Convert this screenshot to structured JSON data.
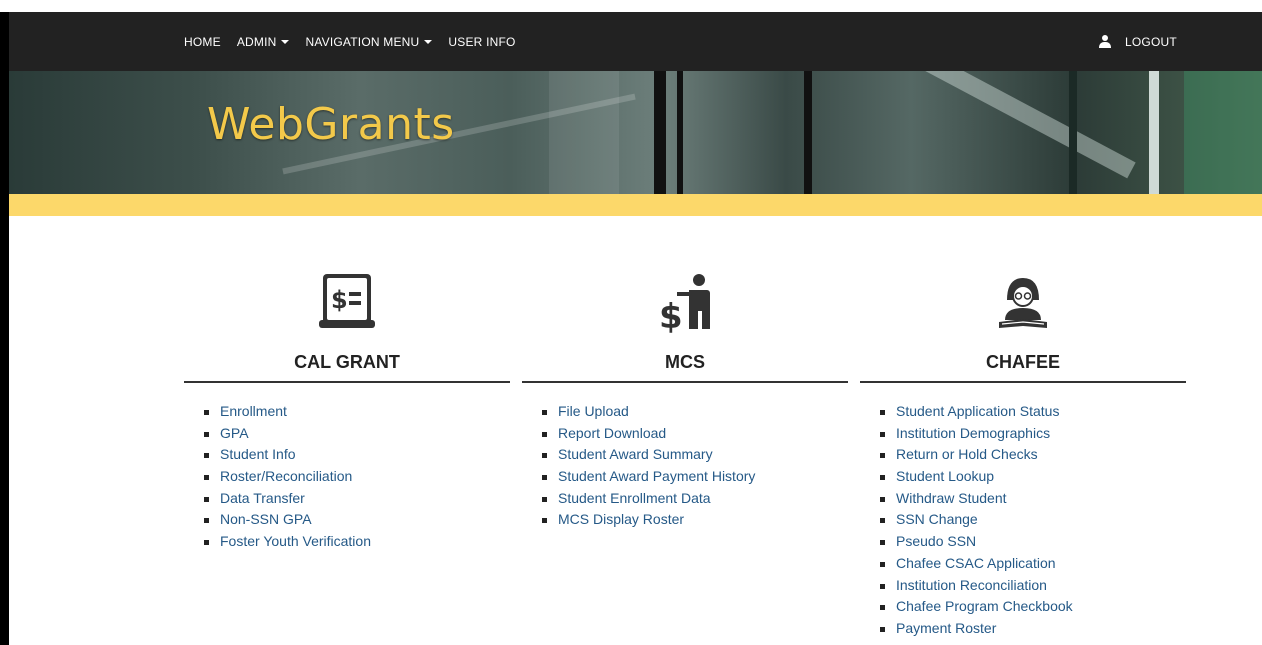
{
  "nav": {
    "items": [
      {
        "label": "HOME",
        "dropdown": false
      },
      {
        "label": "ADMIN",
        "dropdown": true
      },
      {
        "label": "NAVIGATION MENU",
        "dropdown": true
      },
      {
        "label": "USER INFO",
        "dropdown": false
      }
    ],
    "logout_label": "LOGOUT",
    "user_icon": "user-icon"
  },
  "hero": {
    "title": "WebGrants"
  },
  "colors": {
    "navbar": "#222222",
    "title": "#f3c94a",
    "band": "#fcd86a",
    "link": "#255987"
  },
  "sections": [
    {
      "title": "CAL GRANT",
      "icon": "receipt-dollar-icon",
      "links": [
        "Enrollment",
        "GPA",
        "Student Info",
        "Roster/Reconciliation",
        "Data Transfer",
        "Non-SSN GPA",
        "Foster Youth Verification"
      ]
    },
    {
      "title": "MCS",
      "icon": "presenter-dollar-icon",
      "links": [
        "File Upload",
        "Report Download",
        "Student Award Summary",
        "Student Award Payment History",
        "Student Enrollment Data",
        "MCS Display Roster"
      ]
    },
    {
      "title": "CHAFEE",
      "icon": "student-reading-icon",
      "links": [
        "Student Application Status",
        "Institution Demographics",
        "Return or Hold Checks",
        "Student Lookup",
        "Withdraw Student",
        "SSN Change",
        "Pseudo SSN",
        "Chafee CSAC Application",
        "Institution Reconciliation",
        "Chafee Program Checkbook",
        "Payment Roster"
      ]
    }
  ]
}
